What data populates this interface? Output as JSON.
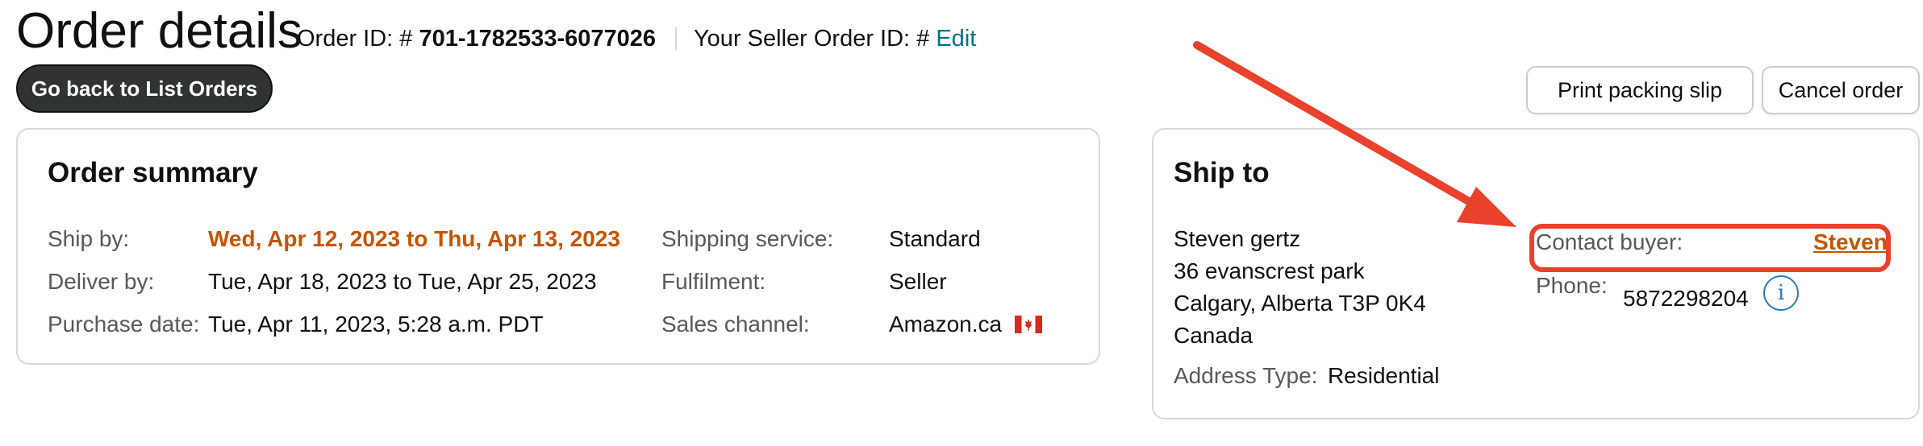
{
  "header": {
    "title": "Order details",
    "order_id_prefix": "Order ID: # ",
    "order_id": "701-1782533-6077026",
    "seller_id_label": "Your Seller Order ID: # ",
    "seller_id_edit": "Edit"
  },
  "actions": {
    "back_label": "Go back to List Orders",
    "print_label": "Print packing slip",
    "cancel_label": "Cancel order"
  },
  "order_summary": {
    "title": "Order summary",
    "ship_by_label": "Ship by:",
    "ship_by_value": "Wed, Apr 12, 2023 to Thu, Apr 13, 2023",
    "deliver_by_label": "Deliver by:",
    "deliver_by_value": "Tue, Apr 18, 2023 to Tue, Apr 25, 2023",
    "purchase_date_label": "Purchase date:",
    "purchase_date_value": "Tue, Apr 11, 2023, 5:28 a.m. PDT",
    "shipping_service_label": "Shipping service:",
    "shipping_service_value": "Standard",
    "fulfilment_label": "Fulfilment:",
    "fulfilment_value": "Seller",
    "sales_channel_label": "Sales channel:",
    "sales_channel_value": "Amazon.ca",
    "sales_channel_icon": "canada-flag-icon"
  },
  "ship_to": {
    "title": "Ship to",
    "name": "Steven gertz",
    "address_line1": "36 evanscrest park",
    "address_line2": "Calgary, Alberta T3P 0K4",
    "country": "Canada",
    "address_type_label": "Address Type:",
    "address_type_value": "Residential",
    "contact_label": "Contact buyer:",
    "contact_value": "Steven",
    "phone_label": "Phone:",
    "phone_value": "5872298204",
    "info_icon": "i"
  },
  "colors": {
    "accent_orange": "#c45500",
    "link_teal": "#007185",
    "annotation_red": "#e8412c",
    "button_dark": "#303333"
  }
}
